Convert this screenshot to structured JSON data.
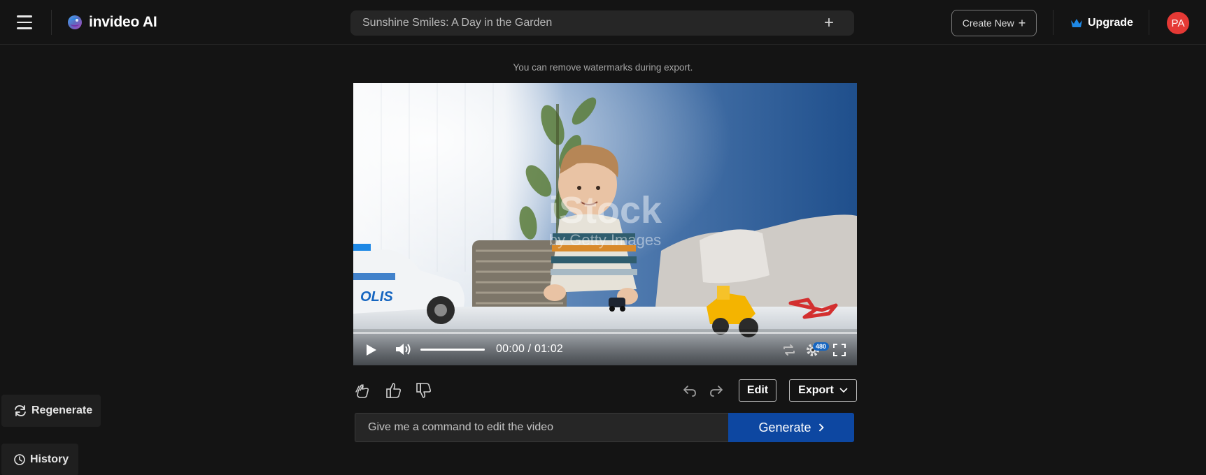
{
  "header": {
    "brand": "invideo AI",
    "project_title": "Sunshine Smiles: A Day in the Garden",
    "create_new_label": "Create New",
    "upgrade_label": "Upgrade",
    "avatar_initials": "PA"
  },
  "notice": "You can remove watermarks during export.",
  "player": {
    "current_time": "00:00",
    "duration": "01:02",
    "time_display": "00:00 / 01:02",
    "quality_badge": "480",
    "progress_fraction": 0.0,
    "volume_fraction": 1.0,
    "watermark_lines": [
      "iStock",
      "by Getty Images"
    ]
  },
  "actions": {
    "edit_label": "Edit",
    "export_label": "Export"
  },
  "command": {
    "placeholder": "Give me a command to edit the video",
    "value": "",
    "generate_label": "Generate"
  },
  "sidebar": {
    "regenerate_label": "Regenerate",
    "history_label": "History"
  },
  "colors": {
    "background": "#141414",
    "accent": "#0d47a1",
    "avatar": "#e53935",
    "upgrade_crown": "#1e88e5"
  },
  "icons": [
    "menu-icon",
    "invideo-logo",
    "plus-icon",
    "crown-icon",
    "play-icon",
    "volume-icon",
    "loop-icon",
    "settings-icon",
    "fullscreen-icon",
    "clap-icon",
    "thumbs-up-icon",
    "thumbs-down-icon",
    "undo-icon",
    "redo-icon",
    "chevron-down-icon",
    "chevron-right-icon",
    "refresh-icon",
    "clock-icon"
  ]
}
